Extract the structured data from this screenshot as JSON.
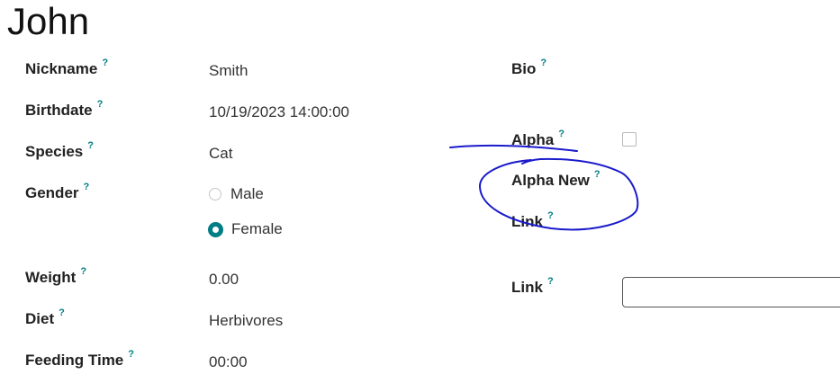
{
  "record": {
    "title": "John"
  },
  "help_mark": "?",
  "left_fields": {
    "nickname": {
      "label": "Nickname",
      "value": "Smith"
    },
    "birthdate": {
      "label": "Birthdate",
      "value": "10/19/2023 14:00:00"
    },
    "species": {
      "label": "Species",
      "value": "Cat"
    },
    "gender": {
      "label": "Gender",
      "options": [
        {
          "label": "Male",
          "selected": false
        },
        {
          "label": "Female",
          "selected": true
        }
      ]
    },
    "weight": {
      "label": "Weight",
      "value": "0.00"
    },
    "diet": {
      "label": "Diet",
      "value": "Herbivores"
    },
    "feeding_time": {
      "label": "Feeding Time",
      "value": "00:00"
    }
  },
  "right_fields": {
    "bio": {
      "label": "Bio",
      "value": ""
    },
    "alpha": {
      "label": "Alpha",
      "checked": false
    },
    "alpha_new": {
      "label": "Alpha New"
    },
    "link_readonly": {
      "label": "Link"
    },
    "link_input": {
      "label": "Link",
      "value": ""
    }
  },
  "annotation": {
    "color": "#1a1acc",
    "shape": "hand-drawn circle with strike line"
  },
  "colors": {
    "accent": "#017e84",
    "label_text": "#222222",
    "value_text": "#333333"
  }
}
